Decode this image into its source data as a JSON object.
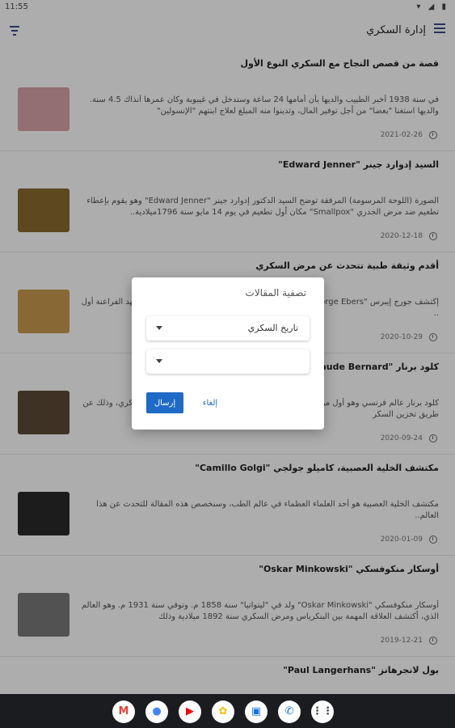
{
  "status_bar": {
    "time": "11:55",
    "icons": "▾ ◢ ▮"
  },
  "app_bar": {
    "title": "إدارة السكري"
  },
  "articles": [
    {
      "title": "قصة من قصص النجاح مع السكري النوع الأول",
      "summary": "في سنة 1938 أخبر الطبيب والديها بأن أمامها 24 ساعة وستدخل في غيبوبة وكان عمرها آنذاك 4.5 سنة. والديها استغنا \"بعضا\" من أجل توفير المال، وتدينوا منه المبلغ لعلاج ابنتهم \"الإنسولين\"",
      "date": "2021-02-26",
      "thumb_color": "#d9a3a8"
    },
    {
      "title": "السيد إدوارد جينر \"Edward Jenner\"",
      "summary": "الصورة (اللوحة المرسومة) المرفقة توضح السيد الدكتور إدوارد جينر \"Edward Jenner\" وهو يقوم بإعطاء تطعيم ضد مرض الجدري \"Smallpox\" مكان أول تطعيم في يوم 14 مايو سنة 1796ميلادية..",
      "date": "2020-12-18",
      "thumb_color": "#8a6a2e"
    },
    {
      "title": "أقدم وثيقة طبية تتحدث عن مرض السكري",
      "summary": "إكتشف جورج إيبرس \"George Ebers\" وهي ورقة بردي ترجع لعام 1552 قبل الميلاد في عهد الفراعنة أول ..",
      "date": "2020-10-29",
      "thumb_color": "#c99a4f"
    },
    {
      "title": "كلود برنار \"Claude Bernard\"",
      "summary": "كلود برنار عالم فرنسي وهو أول من إكتشف دور الكبد في تنظيم السكر بالدم للمصابين بالسكري، وذلك عن طريق تخزين السكر",
      "date": "2020-09-24",
      "thumb_color": "#5a4a36"
    },
    {
      "title": "مكتشف الخلية العصبية، كاميلو جولجي \"Camillo Golgi\"",
      "summary": "مكتشف الخلية العصبية هو أحد العلماء العظماء في عالم الطب، وسنخصص هذه المقالة للتحدث عن هذا العالم..",
      "date": "2020-01-09",
      "thumb_color": "#2a2a2a"
    },
    {
      "title": "أوسكار منكوفسكي \"Oskar Minkowski\"",
      "summary": "أوسكار منكوفسكي \"Oskar Minkowski\" ولد في \"ليتوانيا\" سنة 1858 م. وتوفي سنة 1931 م. وهو العالم الذي، أكتشف العلاقة المهمة بين البنكرياس ومرض السكري سنة 1892 ميلادية وذلك",
      "date": "2019-12-21",
      "thumb_color": "#7a7a7a"
    },
    {
      "title": "بول لانجرهانز \"Paul Langerhans\"",
      "summary": "",
      "date": "",
      "thumb_color": "#9a9a9a"
    }
  ],
  "dialog": {
    "title": "تصفية المقالات",
    "category_select_value": "تاريخ السكري",
    "second_select_value": "",
    "submit_label": "إرسال",
    "cancel_label": "إلغاء"
  },
  "taskbar": {
    "apps": [
      {
        "name": "gmail-icon",
        "glyph": "M",
        "color": "#ea4335"
      },
      {
        "name": "chrome-icon",
        "glyph": "●",
        "color": "#4285f4"
      },
      {
        "name": "youtube-icon",
        "glyph": "▶",
        "color": "#ff0000"
      },
      {
        "name": "photos-icon",
        "glyph": "✿",
        "color": "#fbbc05"
      },
      {
        "name": "messages-icon",
        "glyph": "▣",
        "color": "#1a73e8"
      },
      {
        "name": "phone-icon",
        "glyph": "✆",
        "color": "#1a73e8"
      },
      {
        "name": "app-drawer-icon",
        "glyph": "⋮⋮",
        "color": "#3c4043"
      }
    ]
  }
}
